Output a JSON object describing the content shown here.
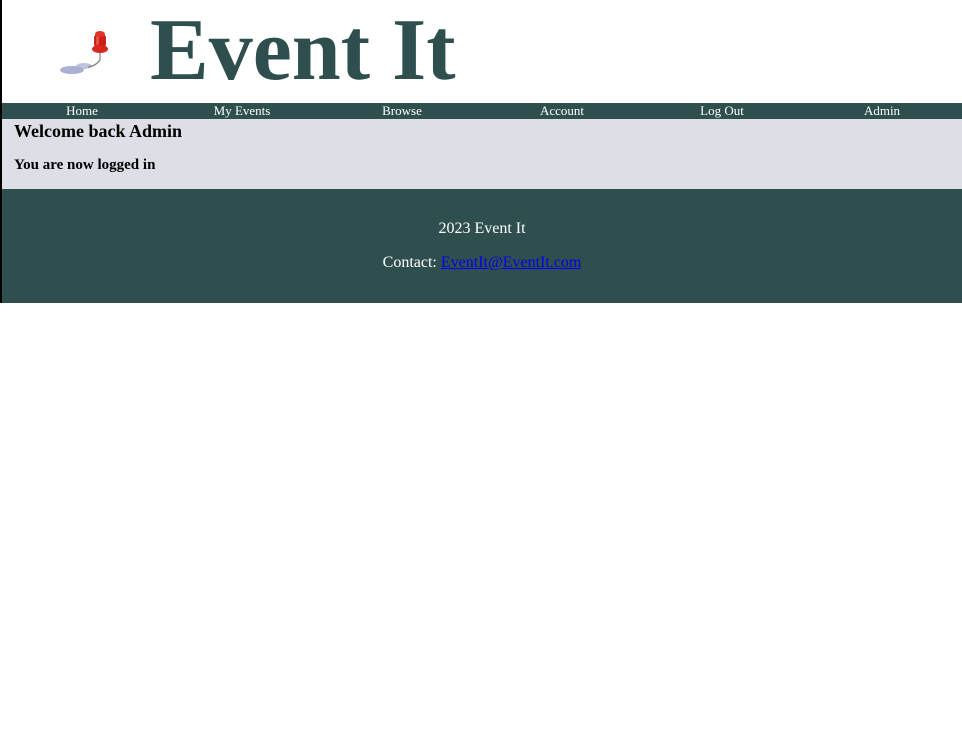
{
  "header": {
    "logo_icon": "pushpin-icon",
    "title": "Event It"
  },
  "nav": {
    "items": [
      {
        "label": "Home"
      },
      {
        "label": "My Events"
      },
      {
        "label": "Browse"
      },
      {
        "label": "Account"
      },
      {
        "label": "Log Out"
      },
      {
        "label": "Admin"
      }
    ]
  },
  "main": {
    "welcome": "Welcome back Admin",
    "status": "You are now logged in"
  },
  "footer": {
    "copyright": "2023 Event It",
    "contact_label": "Contact:",
    "contact_email": "EventIt@EventIt.com"
  },
  "colors": {
    "brand": "#2f4f4f",
    "content_bg": "#dcdfe6",
    "link": "#0000ee",
    "pin_red": "#d9261c"
  }
}
